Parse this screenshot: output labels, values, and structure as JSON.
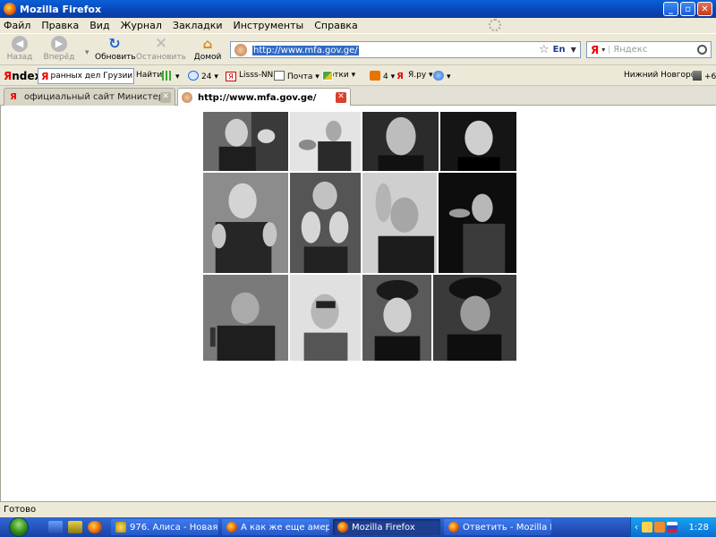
{
  "window": {
    "title": "Mozilla Firefox"
  },
  "menu": [
    "Файл",
    "Правка",
    "Вид",
    "Журнал",
    "Закладки",
    "Инструменты",
    "Справка"
  ],
  "nav": {
    "back": "Назад",
    "forward": "Вперёд",
    "reload": "Обновить",
    "stop": "Остановить",
    "home": "Домой"
  },
  "urlbar": {
    "value": "http://www.mfa.gov.ge/",
    "lang": "En"
  },
  "search": {
    "placeholder": "Яндекс"
  },
  "yabar": {
    "logo_first": "Я",
    "logo_rest": "ndex",
    "query": "ранных дел  Грузии",
    "find": "Найти",
    "messages": "24",
    "lisss": "Lisss-NN",
    "mail": "Почта",
    "photos": "Фотки",
    "counter": "4",
    "yaru": "Я.ру",
    "city": "Нижний Новгород",
    "temp": "+6"
  },
  "tabs": [
    {
      "label": "официальный сайт Министерства ин...",
      "active": false
    },
    {
      "label": "http://www.mfa.gov.ge/",
      "active": true
    }
  ],
  "status": {
    "text": "Готово"
  },
  "taskbar": {
    "tasks": [
      {
        "label": "976. Алиса - Новая ...",
        "pressed": false
      },
      {
        "label": "А как же еще амер...",
        "pressed": false
      },
      {
        "label": "Mozilla Firefox",
        "pressed": true
      },
      {
        "label": "Ответить - Mozilla Fi...",
        "pressed": false
      }
    ],
    "clock": "1:28"
  }
}
